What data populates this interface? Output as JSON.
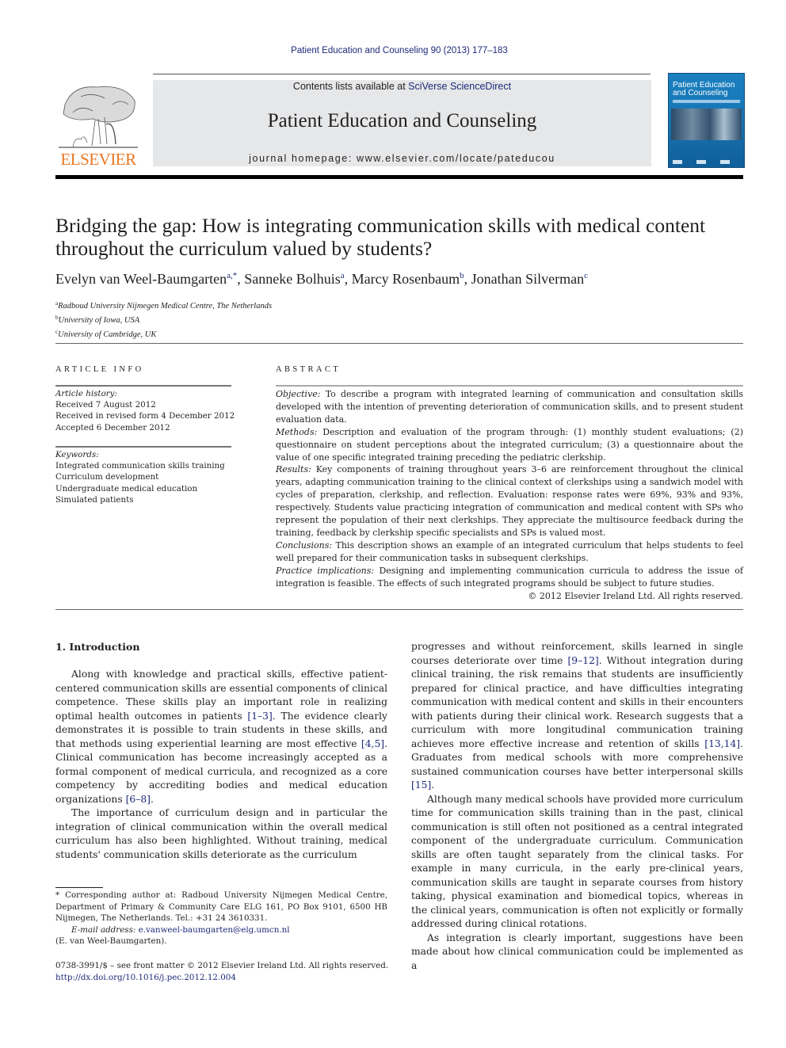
{
  "header": {
    "journal_ref": "Patient Education and Counseling 90 (2013) 177–183",
    "contents_prefix": "Contents lists available at ",
    "contents_link": "SciVerse ScienceDirect",
    "journal_title": "Patient Education and Counseling",
    "homepage": "journal homepage: www.elsevier.com/locate/pateducou",
    "publisher_logo_text": "ELSEVIER",
    "cover_title_line1": "Patient Education",
    "cover_title_line2": "and Counseling"
  },
  "article": {
    "title": "Bridging the gap: How is integrating communication skills with medical content throughout the curriculum valued by students?",
    "authors": [
      {
        "name": "Evelyn van Weel-Baumgarten",
        "sup": "a,*"
      },
      {
        "name": "Sanneke Bolhuis",
        "sup": "a"
      },
      {
        "name": "Marcy Rosenbaum",
        "sup": "b"
      },
      {
        "name": "Jonathan Silverman",
        "sup": "c"
      }
    ],
    "affiliations": [
      {
        "sup": "a",
        "text": "Radboud University Nijmegen Medical Centre, The Netherlands"
      },
      {
        "sup": "b",
        "text": "University of Iowa, USA"
      },
      {
        "sup": "c",
        "text": "University of Cambridge, UK"
      }
    ]
  },
  "article_info": {
    "heading": "ARTICLE INFO",
    "history_label": "Article history:",
    "history": [
      "Received 7 August 2012",
      "Received in revised form 4 December 2012",
      "Accepted 6 December 2012"
    ],
    "keywords_label": "Keywords:",
    "keywords": [
      "Integrated communication skills training",
      "Curriculum development",
      "Undergraduate medical education",
      "Simulated patients"
    ]
  },
  "abstract": {
    "heading": "ABSTRACT",
    "sections": [
      {
        "label": "Objective:",
        "text": " To describe a program with integrated learning of communication and consultation skills developed with the intention of preventing deterioration of communication skills, and to present student evaluation data."
      },
      {
        "label": "Methods:",
        "text": " Description and evaluation of the program through: (1) monthly student evaluations; (2) questionnaire on student perceptions about the integrated curriculum; (3) a questionnaire about the value of one specific integrated training preceding the pediatric clerkship."
      },
      {
        "label": "Results:",
        "text": " Key components of training throughout years 3–6 are reinforcement throughout the clinical years, adapting communication training to the clinical context of clerkships using a sandwich model with cycles of preparation, clerkship, and reflection. Evaluation: response rates were 69%, 93% and 93%, respectively. Students value practicing integration of communication and medical content with SPs who represent the population of their next clerkships. They appreciate the multisource feedback during the training, feedback by clerkship specific specialists and SPs is valued most."
      },
      {
        "label": "Conclusions:",
        "text": "  This description shows an example of an integrated curriculum that helps students to feel well prepared for their communication tasks in subsequent clerkships."
      },
      {
        "label": "Practice implications:",
        "text": "  Designing and implementing communication curricula to address the issue of integration is feasible. The effects of such integrated programs should be subject to future studies."
      }
    ],
    "copyright": "© 2012 Elsevier Ireland Ltd. All rights reserved."
  },
  "body": {
    "intro_heading": "1.  Introduction",
    "left_paragraphs": [
      [
        {
          "t": "Along with knowledge and practical skills, effective patient-centered communication skills are essential components of clinical competence. These skills play an important role in realizing optimal health outcomes in patients "
        },
        {
          "ref": "[1–3]"
        },
        {
          "t": ". The evidence clearly demonstrates it is possible to train students in these skills, and that methods using experiential learning are most effective "
        },
        {
          "ref": "[4,5]"
        },
        {
          "t": ". Clinical communication has become increasingly accepted as a formal component of medical curricula, and recognized as a core competency by accrediting bodies and medical education organizations "
        },
        {
          "ref": "[6–8]"
        },
        {
          "t": "."
        }
      ],
      [
        {
          "t": "The importance of curriculum design and in particular the integration of clinical communication within the overall medical curriculum has also been highlighted. Without training, medical students' communication skills deteriorate as the curriculum"
        }
      ]
    ],
    "right_paragraphs": [
      [
        {
          "t": "progresses and without reinforcement, skills learned in single courses deteriorate over time "
        },
        {
          "ref": "[9–12]"
        },
        {
          "t": ". Without integration during clinical training, the risk remains that students are insufficiently prepared for clinical practice, and have difficulties integrating communication with medical content and skills in their encounters with patients during their clinical work. Research suggests that a curriculum with more longitudinal communication training achieves more effective increase and retention of skills "
        },
        {
          "ref": "[13,14]"
        },
        {
          "t": ". Graduates from medical schools with more comprehensive sustained communication courses have better interpersonal skills "
        },
        {
          "ref": "[15]"
        },
        {
          "t": "."
        }
      ],
      [
        {
          "t": "Although many medical schools have provided more curriculum time for communication skills training than in the past, clinical communication is still often not positioned as a central integrated component of the undergraduate curriculum. Communication skills are often taught separately from the clinical tasks. For example in many curricula, in the early pre-clinical years, communication skills are taught in separate courses from history taking, physical examination and biomedical topics, whereas in the clinical years, communication is often not explicitly or formally addressed during clinical rotations."
        }
      ],
      [
        {
          "t": "As integration is clearly important, suggestions have been made about how clinical communication could be implemented as a"
        }
      ]
    ]
  },
  "footnote": {
    "corresponding": "* Corresponding author at: Radboud University Nijmegen Medical Centre, Department of Primary & Community Care ELG 161, PO Box 9101, 6500 HB Nijmegen, The Netherlands. Tel.: +31 24 3610331.",
    "email_label": "E-mail address:",
    "email": "e.vanweel-baumgarten@elg.umcn.nl",
    "email_name": "(E. van Weel-Baumgarten)."
  },
  "issn": {
    "line": "0738-3991/$ – see front matter © 2012 Elsevier Ireland Ltd. All rights reserved.",
    "doi": "http://dx.doi.org/10.1016/j.pec.2012.12.004"
  },
  "colors": {
    "link": "#1f2a7a",
    "elsevier_orange": "#e87722",
    "banner_gray": "#e6e7e8",
    "cover_blue": "#1a7fc0"
  }
}
